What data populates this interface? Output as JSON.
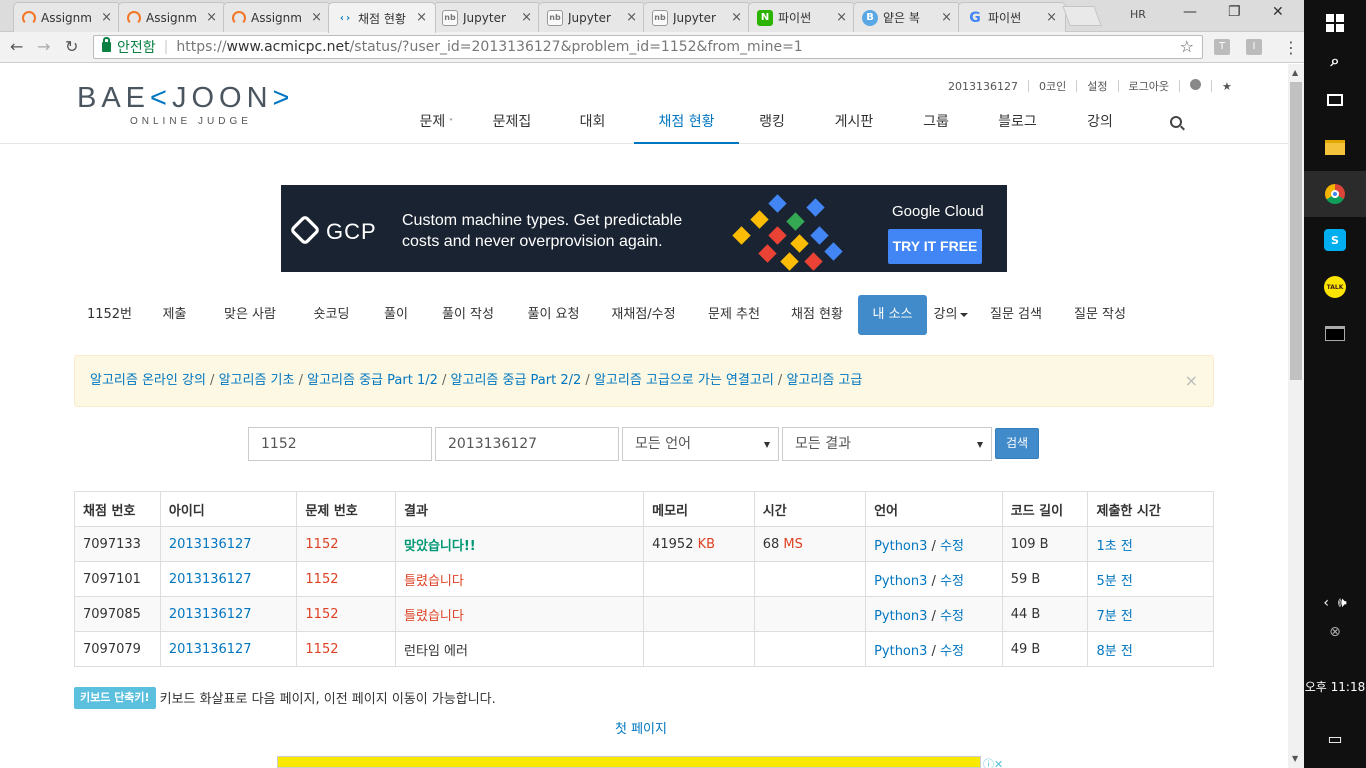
{
  "browser": {
    "tabs": [
      {
        "title": "Assignm",
        "icon": "jupyter-spinner-icon"
      },
      {
        "title": "Assignm",
        "icon": "jupyter-spinner-icon"
      },
      {
        "title": "Assignm",
        "icon": "jupyter-spinner-icon"
      },
      {
        "title": "채점 현황",
        "icon": "baekjoon-icon",
        "active": true
      },
      {
        "title": "Jupyter",
        "icon": "notebook-icon"
      },
      {
        "title": "Jupyter",
        "icon": "notebook-icon"
      },
      {
        "title": "Jupyter",
        "icon": "notebook-icon"
      },
      {
        "title": "파이썬",
        "icon": "naver-icon"
      },
      {
        "title": "얕은 복",
        "icon": "blog-icon"
      },
      {
        "title": "파이썬",
        "icon": "google-icon"
      }
    ],
    "tab_close": "×",
    "profile": "HR",
    "window": {
      "minimize": "—",
      "restore": "❐",
      "close": "✕"
    },
    "nav": {
      "back": "←",
      "forward": "→",
      "reload": "↻"
    },
    "secure_label": "안전함",
    "url_scheme": "https://",
    "url_host": "www.acmicpc.net",
    "url_path": "/status/?user_id=2013136127&problem_id=1152&from_mine=1",
    "star": "☆",
    "ext1": "T",
    "ext2": "I",
    "menu": "⋮"
  },
  "site": {
    "logo_main_left": "BAE",
    "logo_mark_left": "<",
    "logo_mark_right": ">",
    "logo_main_right": "JOON",
    "logo_sub": "ONLINE JUDGE",
    "user_nav": {
      "user_id": "2013136127",
      "coins": "0코인",
      "settings": "설정",
      "logout": "로그아웃",
      "star": "★"
    },
    "main_nav": [
      "문제",
      "문제집",
      "대회",
      "채점 현황",
      "랭킹",
      "게시판",
      "그룹",
      "블로그",
      "강의"
    ],
    "main_nav_active_index": 3
  },
  "ad": {
    "brand": "GCP",
    "copy_line1": "Custom machine types. Get predictable",
    "copy_line2": "costs and never overprovision again.",
    "google_cloud": "Google Cloud",
    "cta": "TRY IT FREE"
  },
  "problem_nav": {
    "items": [
      "1152번",
      "제출",
      "맞은 사람",
      "숏코딩",
      "풀이",
      "풀이 작성",
      "풀이 요청",
      "재채점/수정",
      "문제 추천",
      "채점 현황",
      "내 소스",
      "강의",
      "질문 검색",
      "질문 작성"
    ],
    "active_index": 10
  },
  "alert": {
    "links": [
      "알고리즘 온라인 강의",
      "알고리즘 기초",
      "알고리즘 중급 Part 1/2",
      "알고리즘 중급 Part 2/2",
      "알고리즘 고급으로 가는 연결고리",
      "알고리즘 고급"
    ],
    "separator": " / ",
    "close": "×"
  },
  "search_form": {
    "problem_id": "1152",
    "user_id": "2013136127",
    "language": "모든 언어",
    "result": "모든 결과",
    "button": "검색"
  },
  "results": {
    "headers": [
      "채점 번호",
      "아이디",
      "문제 번호",
      "결과",
      "메모리",
      "시간",
      "언어",
      "코드 길이",
      "제출한 시간"
    ],
    "rows": [
      {
        "id": "7097133",
        "user": "2013136127",
        "problem": "1152",
        "result": "맞았습니다!!",
        "result_type": "correct",
        "memory": "41952",
        "memory_unit": "KB",
        "time": "68",
        "time_unit": "MS",
        "language": "Python3",
        "edit": "수정",
        "length": "109 B",
        "submitted": "1초 전"
      },
      {
        "id": "7097101",
        "user": "2013136127",
        "problem": "1152",
        "result": "틀렸습니다",
        "result_type": "wrong",
        "memory": "",
        "memory_unit": "",
        "time": "",
        "time_unit": "",
        "language": "Python3",
        "edit": "수정",
        "length": "59 B",
        "submitted": "5분 전"
      },
      {
        "id": "7097085",
        "user": "2013136127",
        "problem": "1152",
        "result": "틀렸습니다",
        "result_type": "wrong",
        "memory": "",
        "memory_unit": "",
        "time": "",
        "time_unit": "",
        "language": "Python3",
        "edit": "수정",
        "length": "44 B",
        "submitted": "7분 전"
      },
      {
        "id": "7097079",
        "user": "2013136127",
        "problem": "1152",
        "result": "런타임 에러",
        "result_type": "runtime",
        "memory": "",
        "memory_unit": "",
        "time": "",
        "time_unit": "",
        "language": "Python3",
        "edit": "수정",
        "length": "49 B",
        "submitted": "8분 전"
      }
    ]
  },
  "keyboard": {
    "badge": "키보드 단축키!",
    "text": "키보드 화살표로 다음 페이지, 이전 페이지 이동이 가능합니다."
  },
  "pagination": {
    "first_page": "첫 페이지"
  },
  "taskbar": {
    "kakao": "TALK",
    "clock": "오후 11:18"
  }
}
